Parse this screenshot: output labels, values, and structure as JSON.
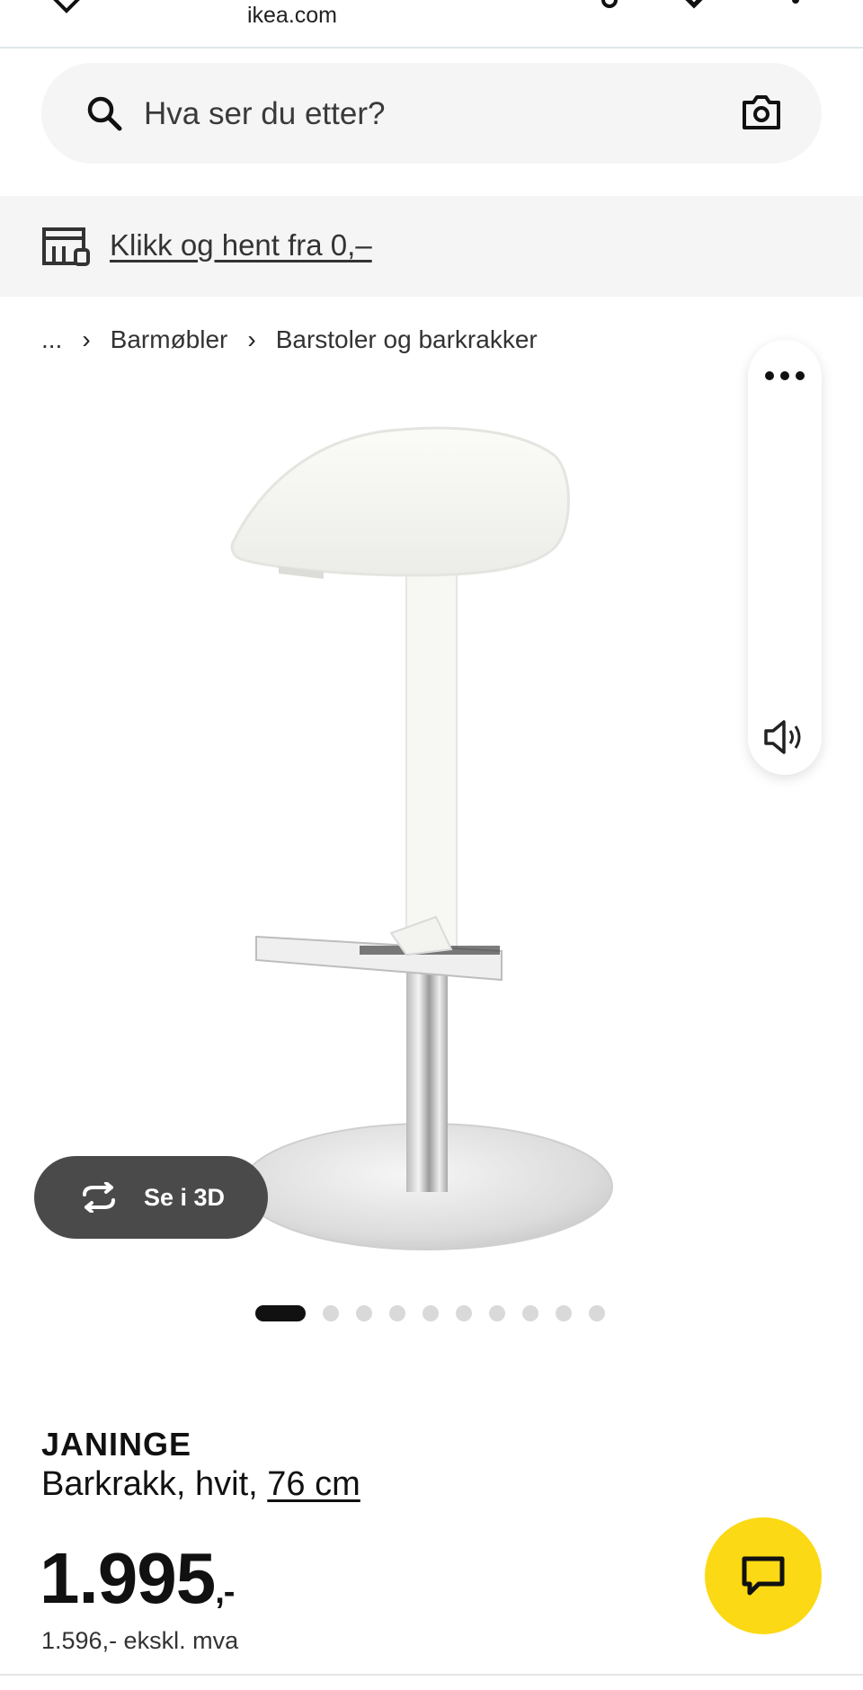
{
  "browser": {
    "url": "ikea.com"
  },
  "search": {
    "placeholder": "Hva ser du etter?"
  },
  "banner": {
    "link": "Klikk og hent fra 0,–"
  },
  "breadcrumb": {
    "items": [
      "...",
      "Barmøbler",
      "Barstoler og barkrakker"
    ]
  },
  "gallery": {
    "button_3d": "Se i 3D",
    "slide_count": 10,
    "active_slide": 1
  },
  "product": {
    "name": "JANINGE",
    "description": "Barkrakk, hvit, ",
    "size_link": "76 cm",
    "price_main": "1.995",
    "price_suffix": ",-",
    "price_ex_vat": "1.596,- ekskl. mva"
  },
  "colors": {
    "chat_button": "#fbd914",
    "button_3d": "#4a4a4a"
  }
}
